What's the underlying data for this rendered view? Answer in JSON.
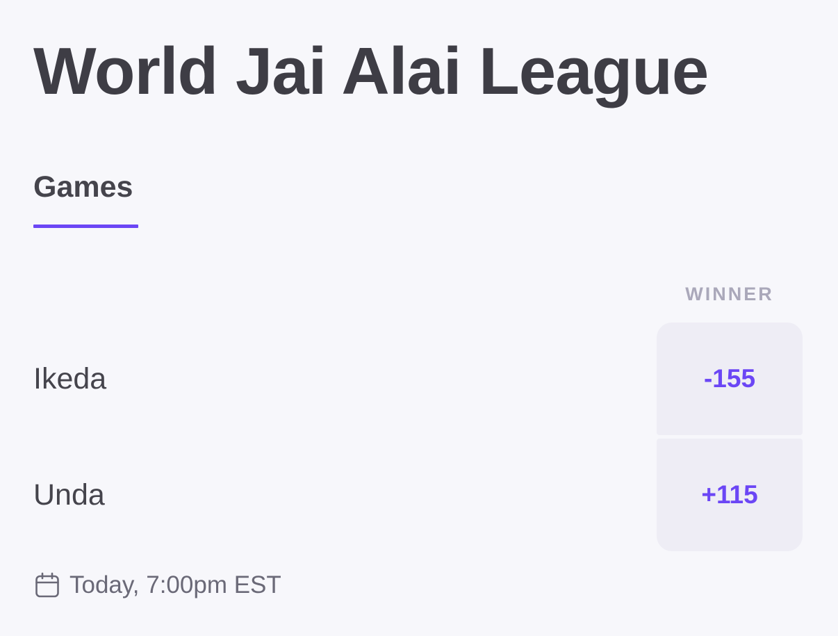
{
  "header": {
    "title": "World Jai Alai League"
  },
  "tabs": [
    {
      "label": "Games",
      "active": true
    }
  ],
  "market": {
    "column_header": "WINNER"
  },
  "game": {
    "teams": [
      {
        "name": "Ikeda",
        "odds": "-155"
      },
      {
        "name": "Unda",
        "odds": "+115"
      }
    ],
    "time": "Today, 7:00pm EST",
    "time_icon": "calendar-icon"
  },
  "colors": {
    "accent": "#6b46f5",
    "background": "#f7f7fb",
    "odds_background": "#eeedf5",
    "text": "#3e3d45",
    "muted": "#aaa8ba"
  }
}
